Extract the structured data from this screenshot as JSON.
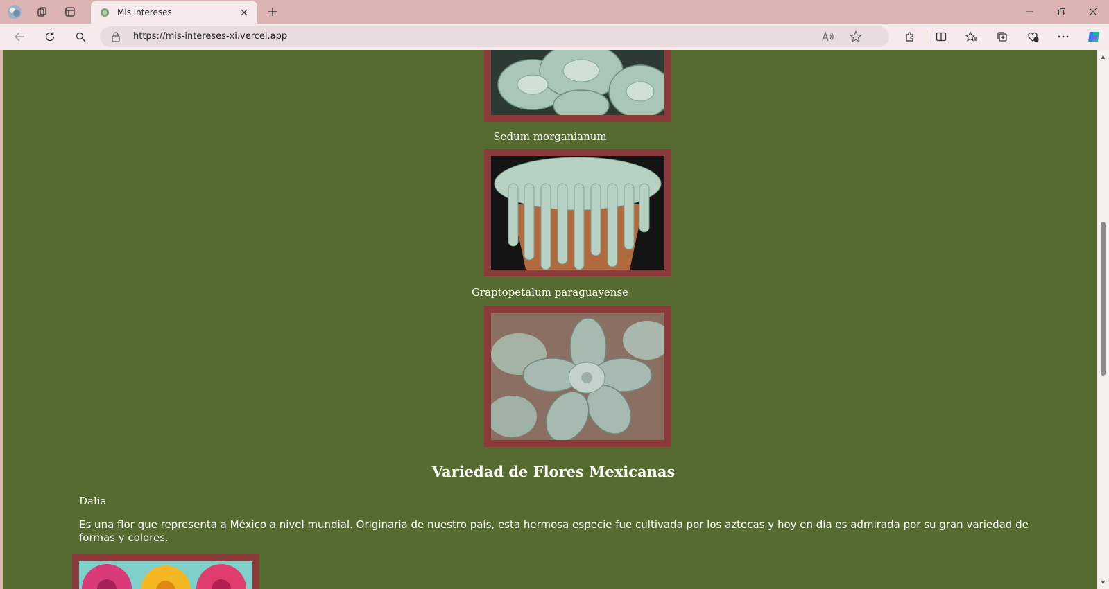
{
  "browser": {
    "tab_title": "Mis intereses",
    "url": "https://mis-intereses-xi.vercel.app"
  },
  "page": {
    "captions": [
      "Sedum morganianum",
      "Graptopetalum paraguayense"
    ],
    "section_title": "Variedad de Flores Mexicanas",
    "flower_name": "Dalia",
    "flower_description": "Es una flor que representa a México a nivel mundial. Originaria de nuestro país, esta hermosa especie fue cultivada por los aztecas y hoy en día es admirada por su gran variedad de formas y colores."
  },
  "colors": {
    "page_background": "#556b2f",
    "frame_border": "#8b3a3a",
    "browser_chrome": "#dbb3b3"
  }
}
